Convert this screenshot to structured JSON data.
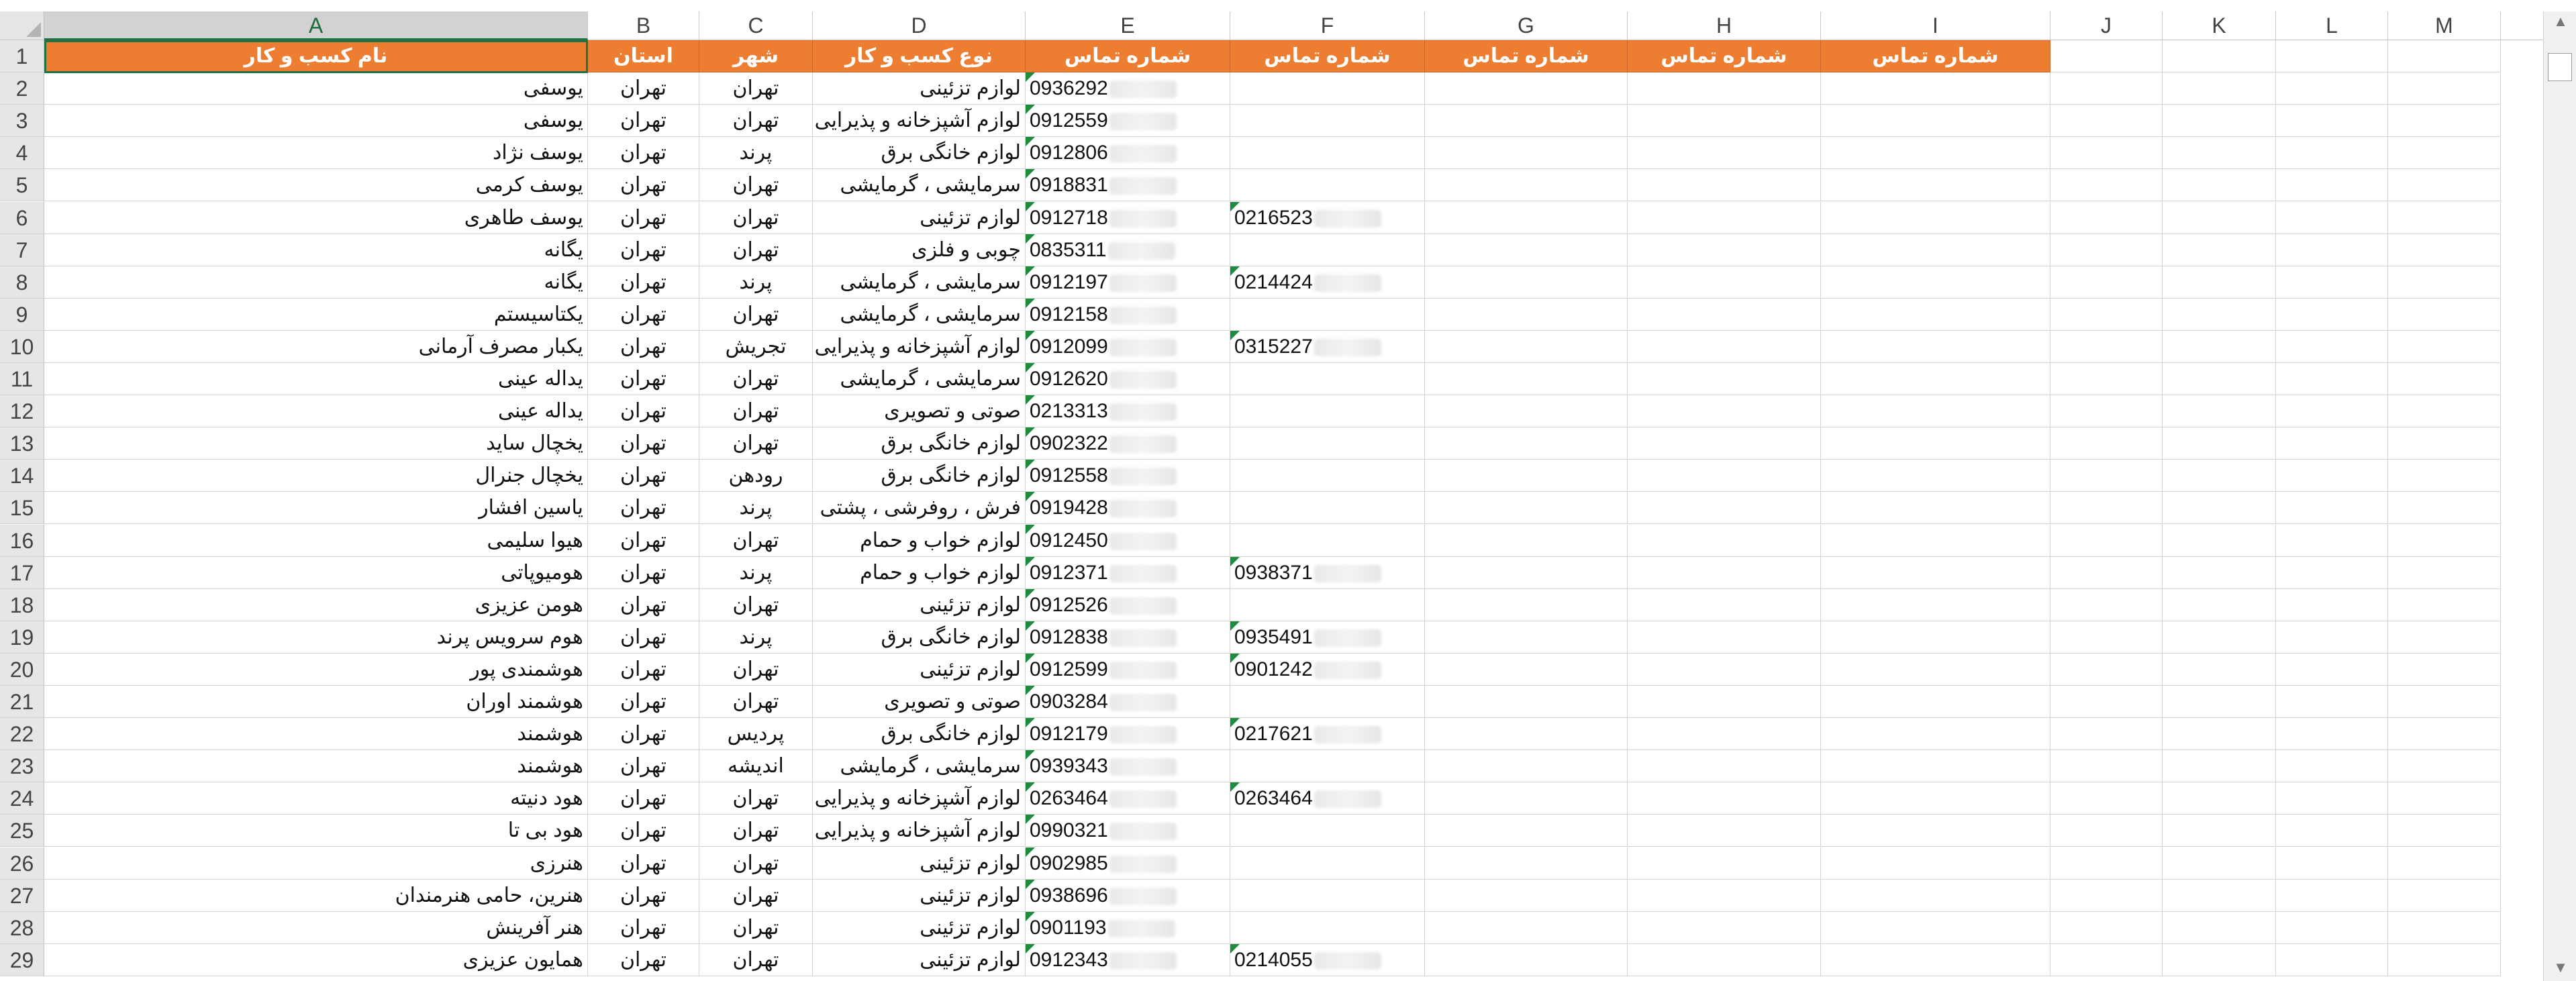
{
  "columns": [
    "A",
    "B",
    "C",
    "D",
    "E",
    "F",
    "G",
    "H",
    "I",
    "J",
    "K",
    "L",
    "M"
  ],
  "headers": {
    "A": "نام کسب و کار",
    "B": "استان",
    "C": "شهر",
    "D": "نوع کسب و کار",
    "E": "شماره تماس",
    "F": "شماره تماس",
    "G": "شماره تماس",
    "H": "شماره تماس",
    "I": "شماره تماس"
  },
  "rows": [
    {
      "n": "2",
      "name": "یوسفی",
      "province": "تهران",
      "city": "تهران",
      "type": "لوازم تزئینی",
      "phone1": "0936292",
      "phone2": ""
    },
    {
      "n": "3",
      "name": "یوسفی",
      "province": "تهران",
      "city": "تهران",
      "type": "لوازم آشپزخانه و پذیرایی",
      "phone1": "0912559",
      "phone2": ""
    },
    {
      "n": "4",
      "name": "یوسف نژاد",
      "province": "تهران",
      "city": "پرند",
      "type": "لوازم خانگی برق",
      "phone1": "0912806",
      "phone2": ""
    },
    {
      "n": "5",
      "name": "یوسف کرمی",
      "province": "تهران",
      "city": "تهران",
      "type": "سرمایشی ، گرمایشی",
      "phone1": "0918831",
      "phone2": ""
    },
    {
      "n": "6",
      "name": "یوسف طاهری",
      "province": "تهران",
      "city": "تهران",
      "type": "لوازم تزئینی",
      "phone1": "0912718",
      "phone2": "0216523"
    },
    {
      "n": "7",
      "name": "یگانه",
      "province": "تهران",
      "city": "تهران",
      "type": "چوبی و فلزی",
      "phone1": "0835311",
      "phone2": ""
    },
    {
      "n": "8",
      "name": "یگانه",
      "province": "تهران",
      "city": "پرند",
      "type": "سرمایشی ، گرمایشی",
      "phone1": "0912197",
      "phone2": "0214424"
    },
    {
      "n": "9",
      "name": "یکتاسیستم",
      "province": "تهران",
      "city": "تهران",
      "type": "سرمایشی ، گرمایشی",
      "phone1": "0912158",
      "phone2": ""
    },
    {
      "n": "10",
      "name": "یکبار مصرف آرمانی",
      "province": "تهران",
      "city": "تجریش",
      "type": "لوازم آشپزخانه و پذیرایی",
      "phone1": "0912099",
      "phone2": "0315227"
    },
    {
      "n": "11",
      "name": "یداله عینی",
      "province": "تهران",
      "city": "تهران",
      "type": "سرمایشی ، گرمایشی",
      "phone1": "0912620",
      "phone2": ""
    },
    {
      "n": "12",
      "name": "یداله عینی",
      "province": "تهران",
      "city": "تهران",
      "type": "صوتی و تصویری",
      "phone1": "0213313",
      "phone2": ""
    },
    {
      "n": "13",
      "name": "یخچال ساید",
      "province": "تهران",
      "city": "تهران",
      "type": "لوازم خانگی برق",
      "phone1": "0902322",
      "phone2": ""
    },
    {
      "n": "14",
      "name": "یخچال جنرال",
      "province": "تهران",
      "city": "رودهن",
      "type": "لوازم خانگی برق",
      "phone1": "0912558",
      "phone2": ""
    },
    {
      "n": "15",
      "name": "یاسین افشار",
      "province": "تهران",
      "city": "پرند",
      "type": "فرش ، روفرشی ، پشتی",
      "phone1": "0919428",
      "phone2": ""
    },
    {
      "n": "16",
      "name": "هیوا سلیمی",
      "province": "تهران",
      "city": "تهران",
      "type": "لوازم خواب و حمام",
      "phone1": "0912450",
      "phone2": ""
    },
    {
      "n": "17",
      "name": "هومیوپاتی",
      "province": "تهران",
      "city": "پرند",
      "type": "لوازم خواب و حمام",
      "phone1": "0912371",
      "phone2": "0938371"
    },
    {
      "n": "18",
      "name": "هومن عزیزی",
      "province": "تهران",
      "city": "تهران",
      "type": "لوازم تزئینی",
      "phone1": "0912526",
      "phone2": ""
    },
    {
      "n": "19",
      "name": "هوم سرویس پرند",
      "province": "تهران",
      "city": "پرند",
      "type": "لوازم خانگی برق",
      "phone1": "0912838",
      "phone2": "0935491"
    },
    {
      "n": "20",
      "name": "هوشمندی پور",
      "province": "تهران",
      "city": "تهران",
      "type": "لوازم تزئینی",
      "phone1": "0912599",
      "phone2": "0901242"
    },
    {
      "n": "21",
      "name": "هوشمند اوران",
      "province": "تهران",
      "city": "تهران",
      "type": "صوتی و تصویری",
      "phone1": "0903284",
      "phone2": ""
    },
    {
      "n": "22",
      "name": "هوشمند",
      "province": "تهران",
      "city": "پردیس",
      "type": "لوازم خانگی برق",
      "phone1": "0912179",
      "phone2": "0217621"
    },
    {
      "n": "23",
      "name": "هوشمند",
      "province": "تهران",
      "city": "اندیشه",
      "type": "سرمایشی ، گرمایشی",
      "phone1": "0939343",
      "phone2": ""
    },
    {
      "n": "24",
      "name": "هود دنیته",
      "province": "تهران",
      "city": "تهران",
      "type": "لوازم آشپزخانه و پذیرایی",
      "phone1": "0263464",
      "phone2": "0263464"
    },
    {
      "n": "25",
      "name": "هود بی تا",
      "province": "تهران",
      "city": "تهران",
      "type": "لوازم آشپزخانه و پذیرایی",
      "phone1": "0990321",
      "phone2": ""
    },
    {
      "n": "26",
      "name": "هنرزی",
      "province": "تهران",
      "city": "تهران",
      "type": "لوازم تزئینی",
      "phone1": "0902985",
      "phone2": ""
    },
    {
      "n": "27",
      "name": "هنرین، حامی هنرمندان",
      "province": "تهران",
      "city": "تهران",
      "type": "لوازم تزئینی",
      "phone1": "0938696",
      "phone2": ""
    },
    {
      "n": "28",
      "name": "هنر آفرینش",
      "province": "تهران",
      "city": "تهران",
      "type": "لوازم تزئینی",
      "phone1": "0901193",
      "phone2": ""
    },
    {
      "n": "29",
      "name": "همایون عزیزی",
      "province": "تهران",
      "city": "تهران",
      "type": "لوازم تزئینی",
      "phone1": "0912343",
      "phone2": "0214055"
    }
  ]
}
